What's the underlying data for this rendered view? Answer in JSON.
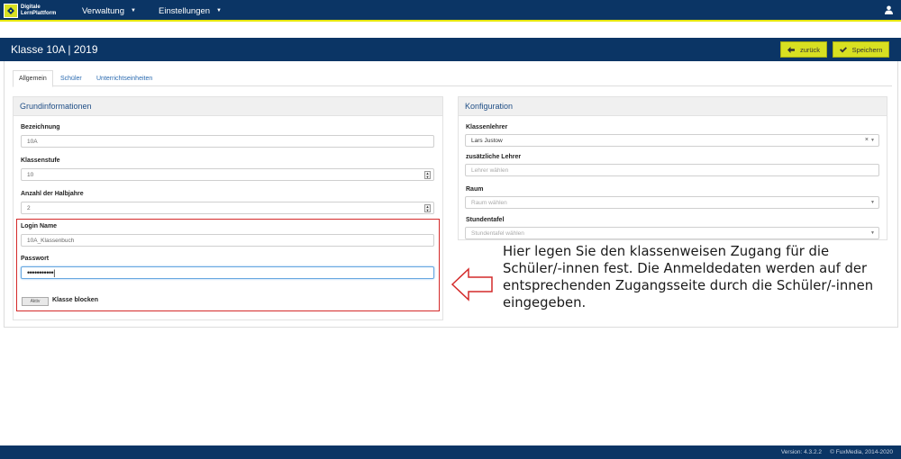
{
  "app": {
    "logo_line1": "Digitale",
    "logo_line2": "LernPlattform"
  },
  "nav": {
    "items": [
      {
        "label": "Verwaltung"
      },
      {
        "label": "Einstellungen"
      }
    ]
  },
  "header": {
    "title": "Klasse 10A | 2019",
    "back_label": "zurück",
    "save_label": "Speichern"
  },
  "tabs": [
    {
      "label": "Allgemein",
      "active": true
    },
    {
      "label": "Schüler",
      "active": false
    },
    {
      "label": "Unterrichtseinheiten",
      "active": false
    }
  ],
  "grundinformationen": {
    "heading": "Grundinformationen",
    "bezeichnung_label": "Bezeichnung",
    "bezeichnung_value": "10A",
    "klassenstufe_label": "Klassenstufe",
    "klassenstufe_value": "10",
    "halbjahre_label": "Anzahl der Halbjahre",
    "halbjahre_value": "2",
    "login_label": "Login Name",
    "login_value": "10A_Klassenbuch",
    "passwort_label": "Passwort",
    "passwort_value": "•••••••••••",
    "toggle_label": "Aktiv",
    "blocken_label": "Klasse blocken"
  },
  "konfiguration": {
    "heading": "Konfiguration",
    "klassenlehrer_label": "Klassenlehrer",
    "klassenlehrer_value": "Lars Justow",
    "zusatz_label": "zusätzliche Lehrer",
    "zusatz_placeholder": "Lehrer wählen",
    "raum_label": "Raum",
    "raum_placeholder": "Raum wählen",
    "stundentafel_label": "Stundentafel",
    "stundentafel_placeholder": "Stundentafel wählen"
  },
  "callout": {
    "text": "Hier legen Sie den klassenweisen Zugang für die Schüler/-innen fest. Die Anmeldedaten werden auf der entsprechenden Zugangsseite durch die Schüler/-innen eingegeben."
  },
  "footer": {
    "version": "Version: 4.3.2.2",
    "copyright": "© FuxMedia, 2014-2020"
  },
  "colors": {
    "navy": "#0b3565",
    "accent": "#d8e021",
    "highlight": "#d42a2a"
  }
}
